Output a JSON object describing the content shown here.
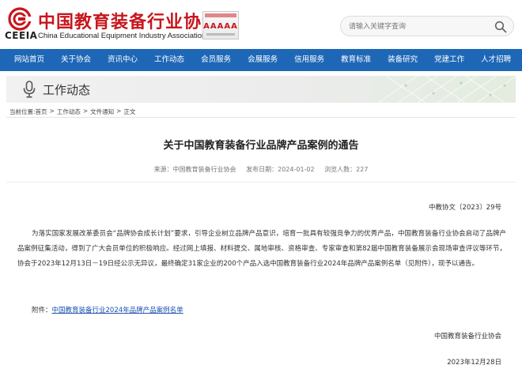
{
  "header": {
    "org_name_cn": "中国教育装备行业协会",
    "org_abbr": "CEEIA",
    "org_name_en": "China Educational Equipment Industry Association",
    "badge_text": "AAAAA",
    "search_placeholder": "请输入关键字查询",
    "brand_color": "#c8161d"
  },
  "nav": {
    "items": [
      "网站首页",
      "关于协会",
      "资讯中心",
      "工作动态",
      "会员服务",
      "会展服务",
      "信用服务",
      "教育标准",
      "装备研究",
      "党建工作",
      "人才招聘"
    ],
    "color": "#1e67b7"
  },
  "banner": {
    "title": "工作动态"
  },
  "breadcrumb": {
    "label": "当前位置:",
    "items": [
      "首页",
      "工作动态",
      "文件通知",
      "正文"
    ]
  },
  "article": {
    "title": "关于中国教育装备行业品牌产品案例的通告",
    "source": "来源：中国教育装备行业协会",
    "published": "发布日期：2024-01-02",
    "views": "浏览人数：227",
    "doc_number": "中教协文〔2023〕29号",
    "body": "为落实国家发展改革委员会“品牌协会成长计划”要求，引导企业树立品牌产品意识，培育一批具有较强竞争力的优秀产品，中国教育装备行业协会启动了品牌产品案例征集活动，得到了广大会员单位的积极响应。经过网上填报、材料提交、属地审核、资格审查、专家审查和第82届中国教育装备展示会现场审查评议等环节，协会于2023年12月13日－19日经公示无异议，最终确定31家企业的200个产品入选中国教育装备行业2024年品牌产品案例名单（见附件），现予以通告。",
    "attachment_label": "附件：",
    "attachment_link": "中国教育装备行业2024年品牌产品案例名单",
    "signature": "中国教育装备行业协会",
    "date": "2023年12月28日"
  }
}
